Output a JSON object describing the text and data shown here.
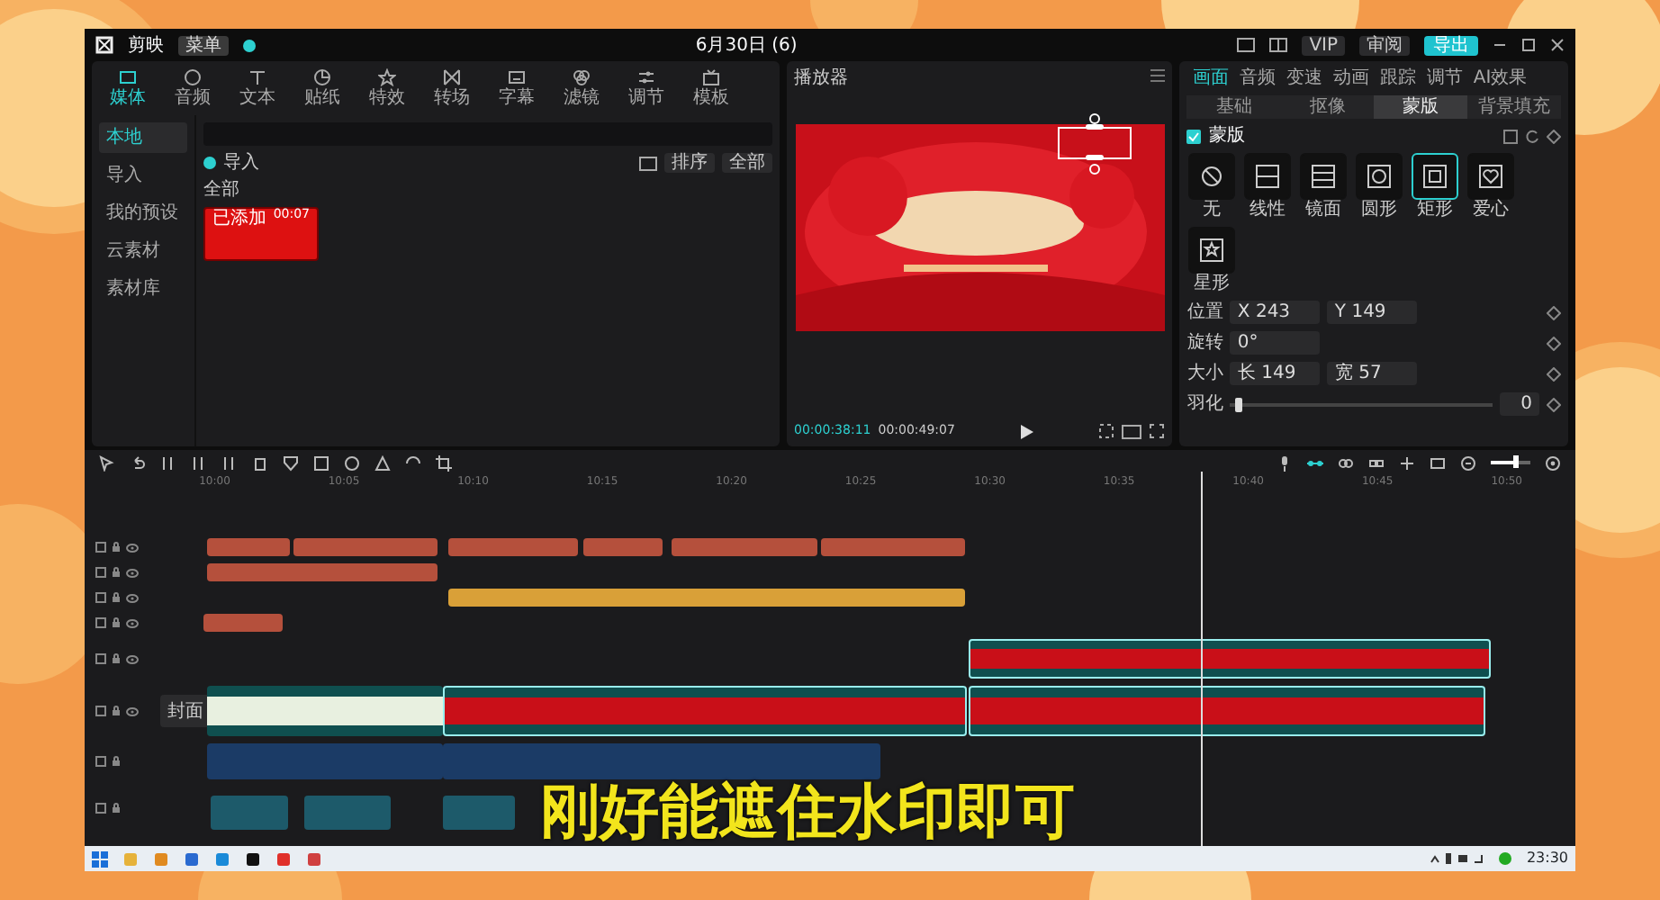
{
  "title_bar": {
    "logo": "剪映",
    "menu": "菜单",
    "date": "6月30日 (6)",
    "vip": "VIP",
    "review": "审阅",
    "export": "导出"
  },
  "media_tabs": [
    {
      "label": "媒体",
      "selected": true
    },
    {
      "label": "音频",
      "selected": false
    },
    {
      "label": "文本",
      "selected": false
    },
    {
      "label": "贴纸",
      "selected": false
    },
    {
      "label": "特效",
      "selected": false
    },
    {
      "label": "转场",
      "selected": false
    },
    {
      "label": "字幕",
      "selected": false
    },
    {
      "label": "滤镜",
      "selected": false
    },
    {
      "label": "调节",
      "selected": false
    },
    {
      "label": "模板",
      "selected": false
    }
  ],
  "media_sidebar": [
    {
      "label": "本地",
      "selected": true
    },
    {
      "label": "导入",
      "selected": false
    },
    {
      "label": "我的预设",
      "selected": false
    },
    {
      "label": "云素材",
      "selected": false
    },
    {
      "label": "素材库",
      "selected": false
    }
  ],
  "media_panel": {
    "import": "导入",
    "sort": "排序",
    "all": "全部",
    "filter": "全部",
    "clips": [
      {
        "badge": "已添加",
        "duration": "00:07"
      }
    ]
  },
  "player": {
    "title": "播放器",
    "current_time": "00:00:38:11",
    "total_time": "00:00:49:07"
  },
  "inspector": {
    "tabs": [
      {
        "label": "画面",
        "selected": true
      },
      {
        "label": "音频",
        "selected": false
      },
      {
        "label": "变速",
        "selected": false
      },
      {
        "label": "动画",
        "selected": false
      },
      {
        "label": "跟踪",
        "selected": false
      },
      {
        "label": "调节",
        "selected": false
      },
      {
        "label": "AI效果",
        "selected": false
      }
    ],
    "subtabs": [
      {
        "label": "基础",
        "selected": false
      },
      {
        "label": "抠像",
        "selected": false
      },
      {
        "label": "蒙版",
        "selected": true
      },
      {
        "label": "背景填充",
        "selected": false
      }
    ],
    "mask_label": "蒙版",
    "mask_enabled": true,
    "shapes": [
      {
        "label": "无",
        "kind": "none",
        "selected": false
      },
      {
        "label": "线性",
        "kind": "linear",
        "selected": false
      },
      {
        "label": "镜面",
        "kind": "mirror",
        "selected": false
      },
      {
        "label": "圆形",
        "kind": "circle",
        "selected": false
      },
      {
        "label": "矩形",
        "kind": "rect",
        "selected": true
      },
      {
        "label": "爱心",
        "kind": "heart",
        "selected": false
      },
      {
        "label": "星形",
        "kind": "star",
        "selected": false
      }
    ],
    "properties": [
      {
        "label": "位置",
        "fields": [
          {
            "prefix": "X",
            "value": "243"
          },
          {
            "prefix": "Y",
            "value": "149"
          }
        ]
      },
      {
        "label": "旋转",
        "fields": [
          {
            "value": "0°"
          }
        ]
      },
      {
        "label": "大小",
        "fields": [
          {
            "prefix": "长",
            "value": "149"
          },
          {
            "prefix": "宽",
            "value": "57"
          }
        ]
      }
    ],
    "feather": {
      "label": "羽化",
      "level": 0.02,
      "value": "0"
    }
  },
  "timeline": {
    "ticks": [
      "10:00",
      "10:05",
      "10:10",
      "10:15",
      "10:20",
      "10:25",
      "10:30",
      "10:35",
      "10:40",
      "10:45",
      "10:50"
    ],
    "cover": "封面",
    "zoom": {
      "level": 0.65
    },
    "tracks": [
      {
        "kind": "text",
        "clips": [
          {
            "kind": "text"
          },
          {
            "kind": "text"
          },
          {
            "kind": "text"
          },
          {
            "kind": "text"
          },
          {
            "kind": "text"
          },
          {
            "kind": "text"
          }
        ]
      },
      {
        "kind": "text",
        "clips": [
          {
            "kind": "text"
          }
        ]
      },
      {
        "kind": "sticker",
        "clips": [
          {
            "kind": "sticker"
          }
        ]
      },
      {
        "kind": "text",
        "clips": [
          {
            "kind": "text"
          }
        ]
      },
      {
        "kind": "video",
        "clips": [
          {
            "kind": "red_video"
          }
        ]
      },
      {
        "kind": "main",
        "clips": [
          {
            "kind": "vlog_video"
          },
          {
            "kind": "red_video"
          },
          {
            "kind": "red_video"
          }
        ]
      },
      {
        "kind": "audio",
        "clips": [
          {
            "kind": "audio"
          },
          {
            "kind": "audio"
          }
        ]
      },
      {
        "kind": "audio",
        "clips": [
          {
            "kind": "voice"
          },
          {
            "kind": "voice"
          },
          {
            "kind": "voice"
          }
        ]
      }
    ]
  },
  "caption": "刚好能遮住水印即可",
  "taskbar": {
    "clock": "23:30"
  }
}
